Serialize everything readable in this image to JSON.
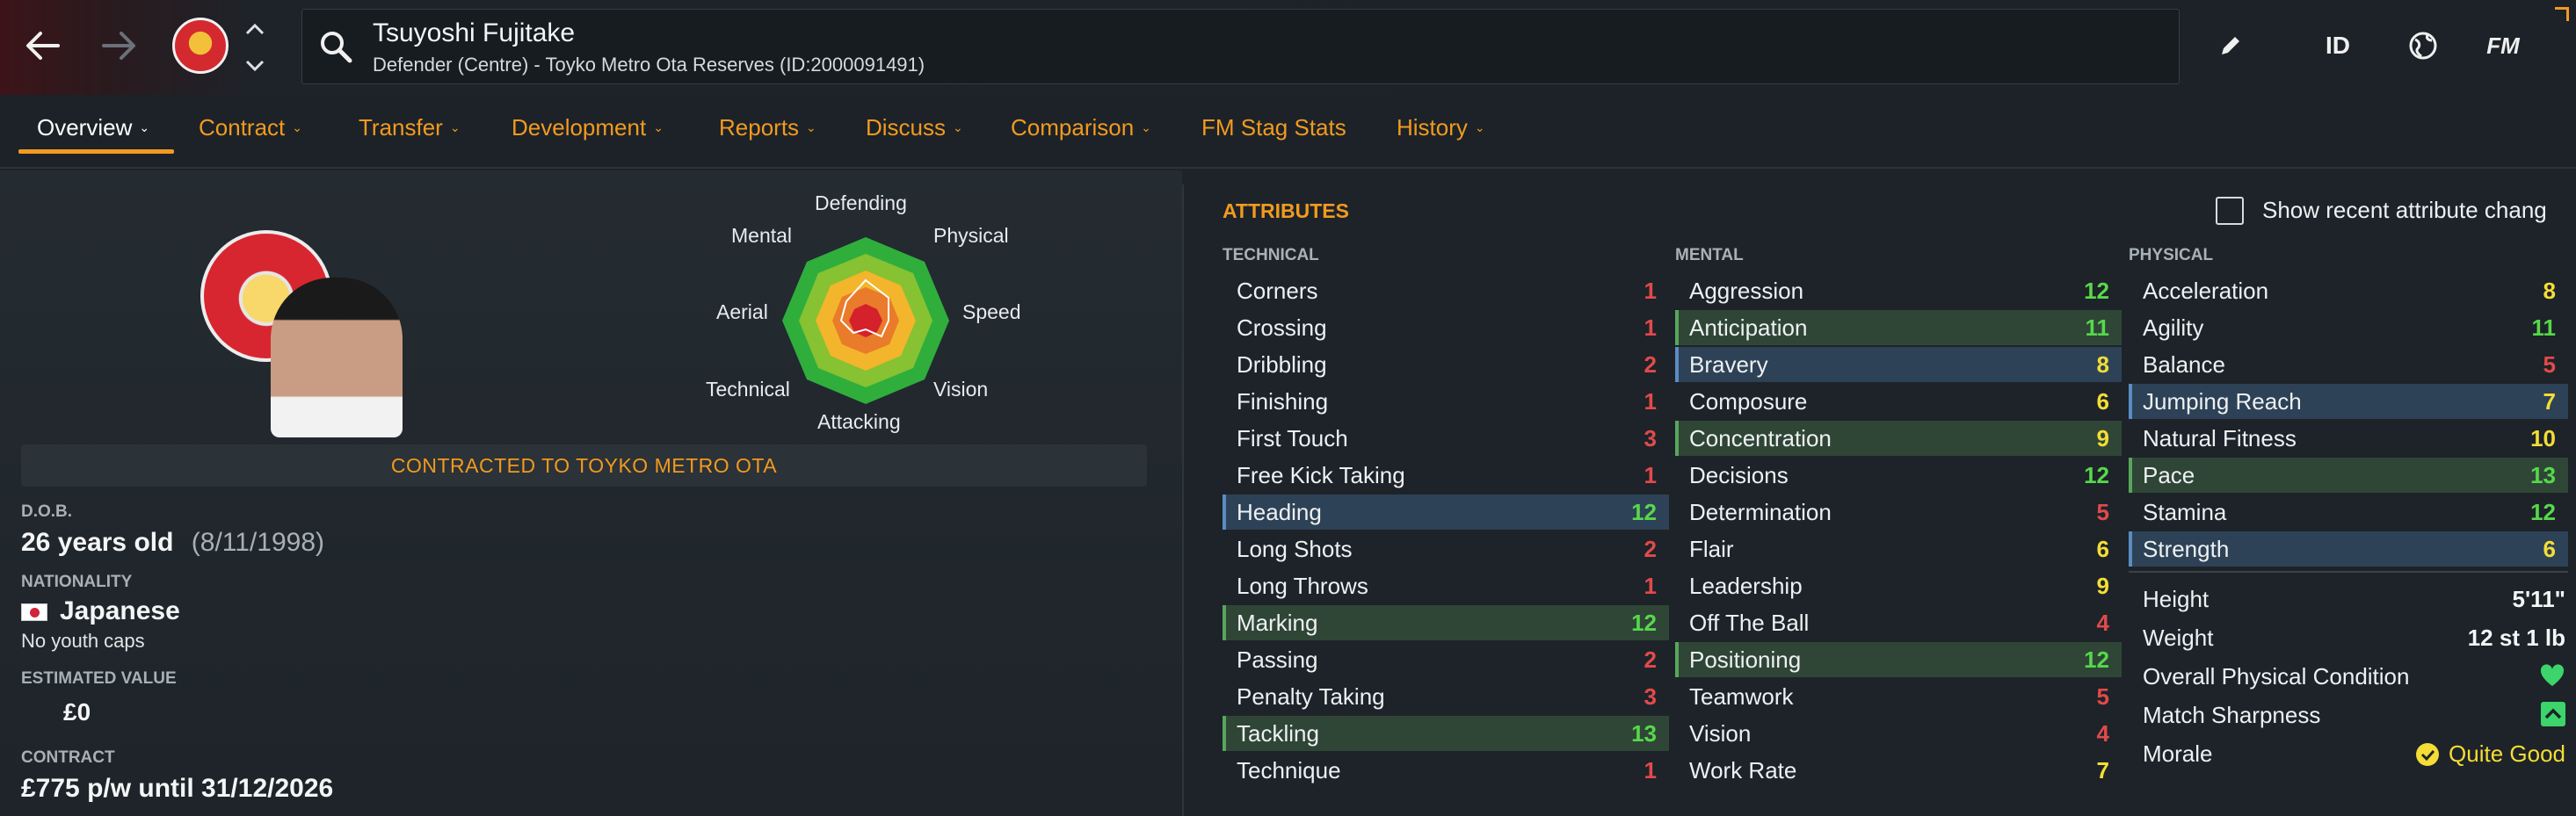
{
  "header": {
    "player_name": "Tsuyoshi Fujitake",
    "player_subtitle": "Defender (Centre) - Toyko Metro Ota Reserves (ID:2000091491)",
    "id_label": "ID",
    "fm_label": "FM",
    "icons": [
      "back-arrow-icon",
      "forward-arrow-icon",
      "club-badge",
      "chevron-up-icon",
      "chevron-down-icon",
      "search-icon",
      "pencil-icon",
      "globe-icon"
    ]
  },
  "tabs": [
    {
      "label": "Overview",
      "active": true
    },
    {
      "label": "Contract"
    },
    {
      "label": "Transfer"
    },
    {
      "label": "Development"
    },
    {
      "label": "Reports"
    },
    {
      "label": "Discuss"
    },
    {
      "label": "Comparison"
    },
    {
      "label": "FM Stag Stats"
    },
    {
      "label": "History"
    }
  ],
  "radar": {
    "labels": {
      "defending": "Defending",
      "physical": "Physical",
      "speed": "Speed",
      "vision": "Vision",
      "attacking": "Attacking",
      "technical": "Technical",
      "aerial": "Aerial",
      "mental": "Mental"
    }
  },
  "profile": {
    "contract_banner": "CONTRACTED TO TOYKO METRO OTA",
    "dob_label": "D.O.B.",
    "age": "26 years old",
    "dob": "(8/11/1998)",
    "nationality_label": "NATIONALITY",
    "nationality": "Japanese",
    "youth_caps": "No youth caps",
    "value_label": "ESTIMATED VALUE",
    "value": "£0",
    "contract_label": "CONTRACT",
    "contract": "£775 p/w until 31/12/2026"
  },
  "attributes": {
    "title": "ATTRIBUTES",
    "show_recent_label": "Show recent attribute chang",
    "technical_head": "TECHNICAL",
    "mental_head": "MENTAL",
    "physical_head": "PHYSICAL",
    "technical": [
      {
        "name": "Corners",
        "value": "1"
      },
      {
        "name": "Crossing",
        "value": "1"
      },
      {
        "name": "Dribbling",
        "value": "2"
      },
      {
        "name": "Finishing",
        "value": "1"
      },
      {
        "name": "First Touch",
        "value": "3"
      },
      {
        "name": "Free Kick Taking",
        "value": "1"
      },
      {
        "name": "Heading",
        "value": "12"
      },
      {
        "name": "Long Shots",
        "value": "2"
      },
      {
        "name": "Long Throws",
        "value": "1"
      },
      {
        "name": "Marking",
        "value": "12"
      },
      {
        "name": "Passing",
        "value": "2"
      },
      {
        "name": "Penalty Taking",
        "value": "3"
      },
      {
        "name": "Tackling",
        "value": "13"
      },
      {
        "name": "Technique",
        "value": "1"
      }
    ],
    "mental": [
      {
        "name": "Aggression",
        "value": "12"
      },
      {
        "name": "Anticipation",
        "value": "11"
      },
      {
        "name": "Bravery",
        "value": "8"
      },
      {
        "name": "Composure",
        "value": "6"
      },
      {
        "name": "Concentration",
        "value": "9"
      },
      {
        "name": "Decisions",
        "value": "12"
      },
      {
        "name": "Determination",
        "value": "5"
      },
      {
        "name": "Flair",
        "value": "6"
      },
      {
        "name": "Leadership",
        "value": "9"
      },
      {
        "name": "Off The Ball",
        "value": "4"
      },
      {
        "name": "Positioning",
        "value": "12"
      },
      {
        "name": "Teamwork",
        "value": "5"
      },
      {
        "name": "Vision",
        "value": "4"
      },
      {
        "name": "Work Rate",
        "value": "7"
      }
    ],
    "physical": [
      {
        "name": "Acceleration",
        "value": "8"
      },
      {
        "name": "Agility",
        "value": "11"
      },
      {
        "name": "Balance",
        "value": "5"
      },
      {
        "name": "Jumping Reach",
        "value": "7"
      },
      {
        "name": "Natural Fitness",
        "value": "10"
      },
      {
        "name": "Pace",
        "value": "13"
      },
      {
        "name": "Stamina",
        "value": "12"
      },
      {
        "name": "Strength",
        "value": "6"
      }
    ],
    "physical_info": {
      "height_label": "Height",
      "height": "5'11\"",
      "weight_label": "Weight",
      "weight": "12 st 1 lb",
      "condition_label": "Overall Physical Condition",
      "sharpness_label": "Match Sharpness",
      "morale_label": "Morale",
      "morale": "Quite Good"
    }
  },
  "colors": {
    "accent": "#f29a1f",
    "value_red": "#e24a4a",
    "value_orange": "#f07c3c",
    "value_yellow": "#f4dd35",
    "value_green": "#57d84a",
    "highlight_blue": "#2d4256",
    "highlight_green": "#2f4637"
  }
}
